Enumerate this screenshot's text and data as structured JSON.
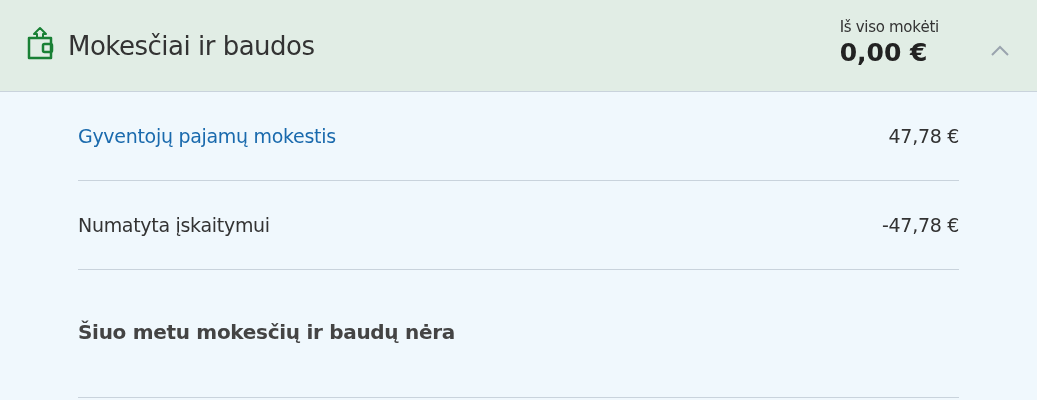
{
  "header": {
    "title": "Mokesčiai ir baudos",
    "total_label": "Iš viso mokėti",
    "total": "0,00 €",
    "expanded": true
  },
  "rows": [
    {
      "kind": "link",
      "label": "Gyventojų pajamų mokestis",
      "amount": "47,78 €"
    },
    {
      "kind": "plain",
      "label": "Numatyta įskaitymui",
      "amount": "-47,78 €"
    },
    {
      "kind": "note",
      "label": "Šiuo metu mokesčių ir baudų nėra"
    }
  ]
}
